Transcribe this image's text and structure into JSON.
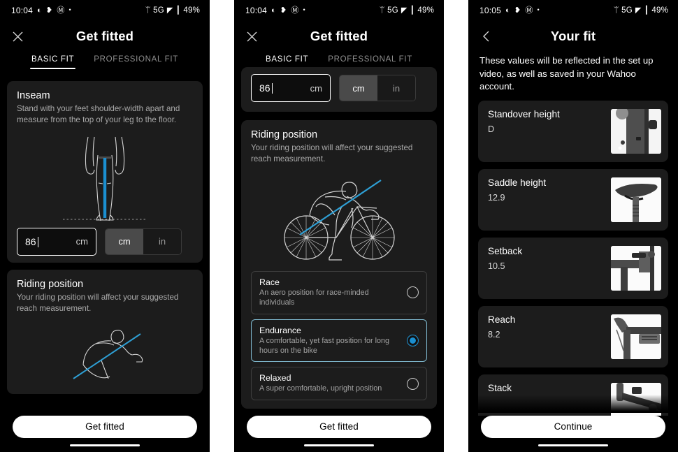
{
  "statusbar": {
    "time_a": "10:04",
    "time_b": "10:05",
    "left_icons": [
      "record-icon",
      "heart-icon",
      "gmail-icon",
      "dot-icon"
    ],
    "bluetooth": "bluetooth-icon",
    "network": "5G",
    "signal": "signal-icon",
    "battery_icon": "battery-icon",
    "battery": "49%"
  },
  "screen1": {
    "close_label": "close-icon",
    "title": "Get fitted",
    "tabs": [
      {
        "label": "BASIC FIT",
        "active": true
      },
      {
        "label": "PROFESSIONAL FIT",
        "active": false
      }
    ],
    "inseam": {
      "title": "Inseam",
      "description": "Stand with your feet shoulder-width apart and measure from the top of your leg to the floor.",
      "value": "86",
      "unit_suffix": "cm",
      "placeholder": "0"
    },
    "units": [
      {
        "label": "cm",
        "selected": true
      },
      {
        "label": "in",
        "selected": false
      }
    ],
    "riding": {
      "title": "Riding position",
      "description": "Your riding position will affect your suggested reach measurement."
    },
    "cta": "Get fitted"
  },
  "screen2": {
    "close_label": "close-icon",
    "title": "Get fitted",
    "tabs": [
      {
        "label": "BASIC FIT",
        "active": true
      },
      {
        "label": "PROFESSIONAL FIT",
        "active": false
      }
    ],
    "inseam": {
      "value": "86",
      "unit_suffix": "cm"
    },
    "units": [
      {
        "label": "cm",
        "selected": true
      },
      {
        "label": "in",
        "selected": false
      }
    ],
    "riding": {
      "title": "Riding position",
      "description": "Your riding position will affect your suggested reach measurement."
    },
    "options": [
      {
        "title": "Race",
        "desc": "An aero position for race-minded individuals",
        "selected": false
      },
      {
        "title": "Endurance",
        "desc": "A comfortable, yet fast position for long hours on the bike",
        "selected": true
      },
      {
        "title": "Relaxed",
        "desc": "A super comfortable, upright position",
        "selected": false
      }
    ],
    "cta": "Get fitted"
  },
  "screen3": {
    "back_label": "back-chevron-icon",
    "title": "Your fit",
    "intro": "These values will be reflected in the set up video, as well as saved in your Wahoo account.",
    "measurements": [
      {
        "label": "Standover height",
        "value": "D",
        "thumb": "seatpost-photo"
      },
      {
        "label": "Saddle height",
        "value": "12.9",
        "thumb": "saddle-photo"
      },
      {
        "label": "Setback",
        "value": "10.5",
        "thumb": "setback-photo"
      },
      {
        "label": "Reach",
        "value": "8.2",
        "thumb": "reach-photo"
      },
      {
        "label": "Stack",
        "value": "",
        "thumb": "stack-photo"
      }
    ],
    "cta": "Continue"
  },
  "colors": {
    "accent": "#1b8fd0",
    "card": "#1c1c1c",
    "background": "#000000",
    "selected_border": "#7fb9cf"
  }
}
